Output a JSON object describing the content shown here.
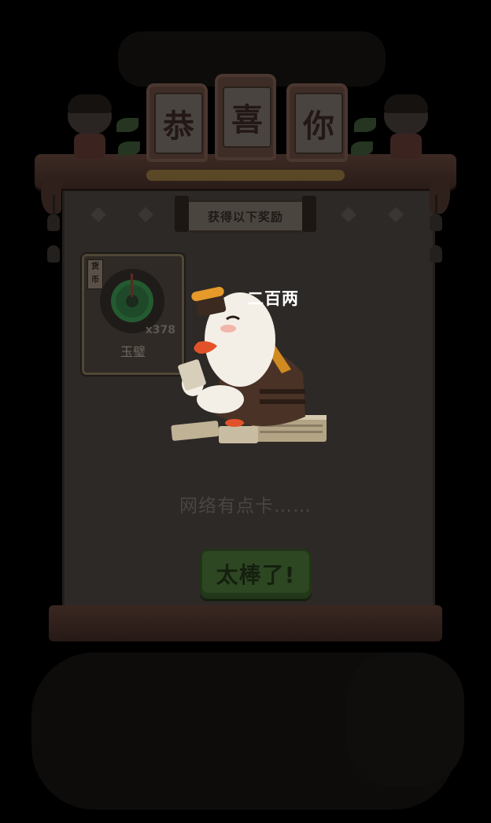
{
  "header": {
    "characters": [
      "恭",
      "喜",
      "你"
    ]
  },
  "banner": {
    "label": "获得以下奖励"
  },
  "reward": {
    "tag": "货币",
    "icon": "jade-disc-icon",
    "count": "x378",
    "name": "玉璧"
  },
  "character": {
    "speech": "二百两"
  },
  "status": {
    "message": "网络有点卡……"
  },
  "confirm_button": {
    "label": "太棒了!"
  },
  "colors": {
    "overlay": "#000000",
    "scroll_paper": "#2d2926",
    "button_green": "#2d4722",
    "speech_text": "#ffffff"
  }
}
